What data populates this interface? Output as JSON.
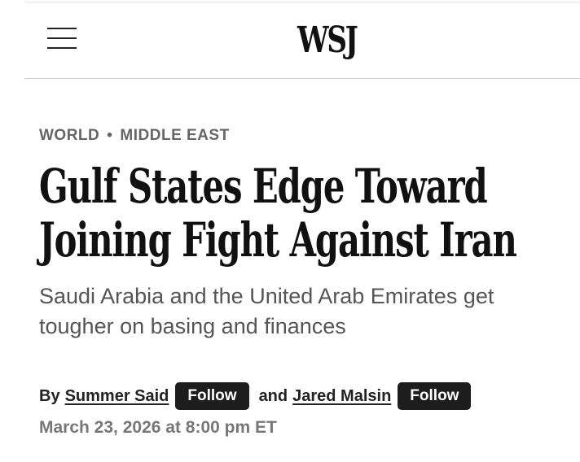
{
  "header": {
    "logo": "WSJ",
    "menu_icon": "hamburger-menu-icon"
  },
  "article": {
    "section": {
      "primary": "WORLD",
      "separator": "•",
      "secondary": "MIDDLE EAST"
    },
    "headline_lines": [
      "Gulf States Edge Toward",
      "Joining Fight Against Iran"
    ],
    "dek": "Saudi Arabia and the United Arab Emirates get tougher on basing and finances",
    "byline": {
      "prefix": "By",
      "conjunction": "and",
      "authors": [
        {
          "name": "Summer Said",
          "follow_label": "Follow"
        },
        {
          "name": "Jared Malsin",
          "follow_label": "Follow"
        }
      ]
    },
    "timestamp": "March 23, 2026 at 8:00 pm ET"
  },
  "colors": {
    "text": "#111111",
    "section": "#666666",
    "dek": "#555555",
    "timestamp": "#777777",
    "button_bg": "#1d1d1d",
    "button_text": "#ffffff",
    "divider": "#cfcfcf"
  }
}
